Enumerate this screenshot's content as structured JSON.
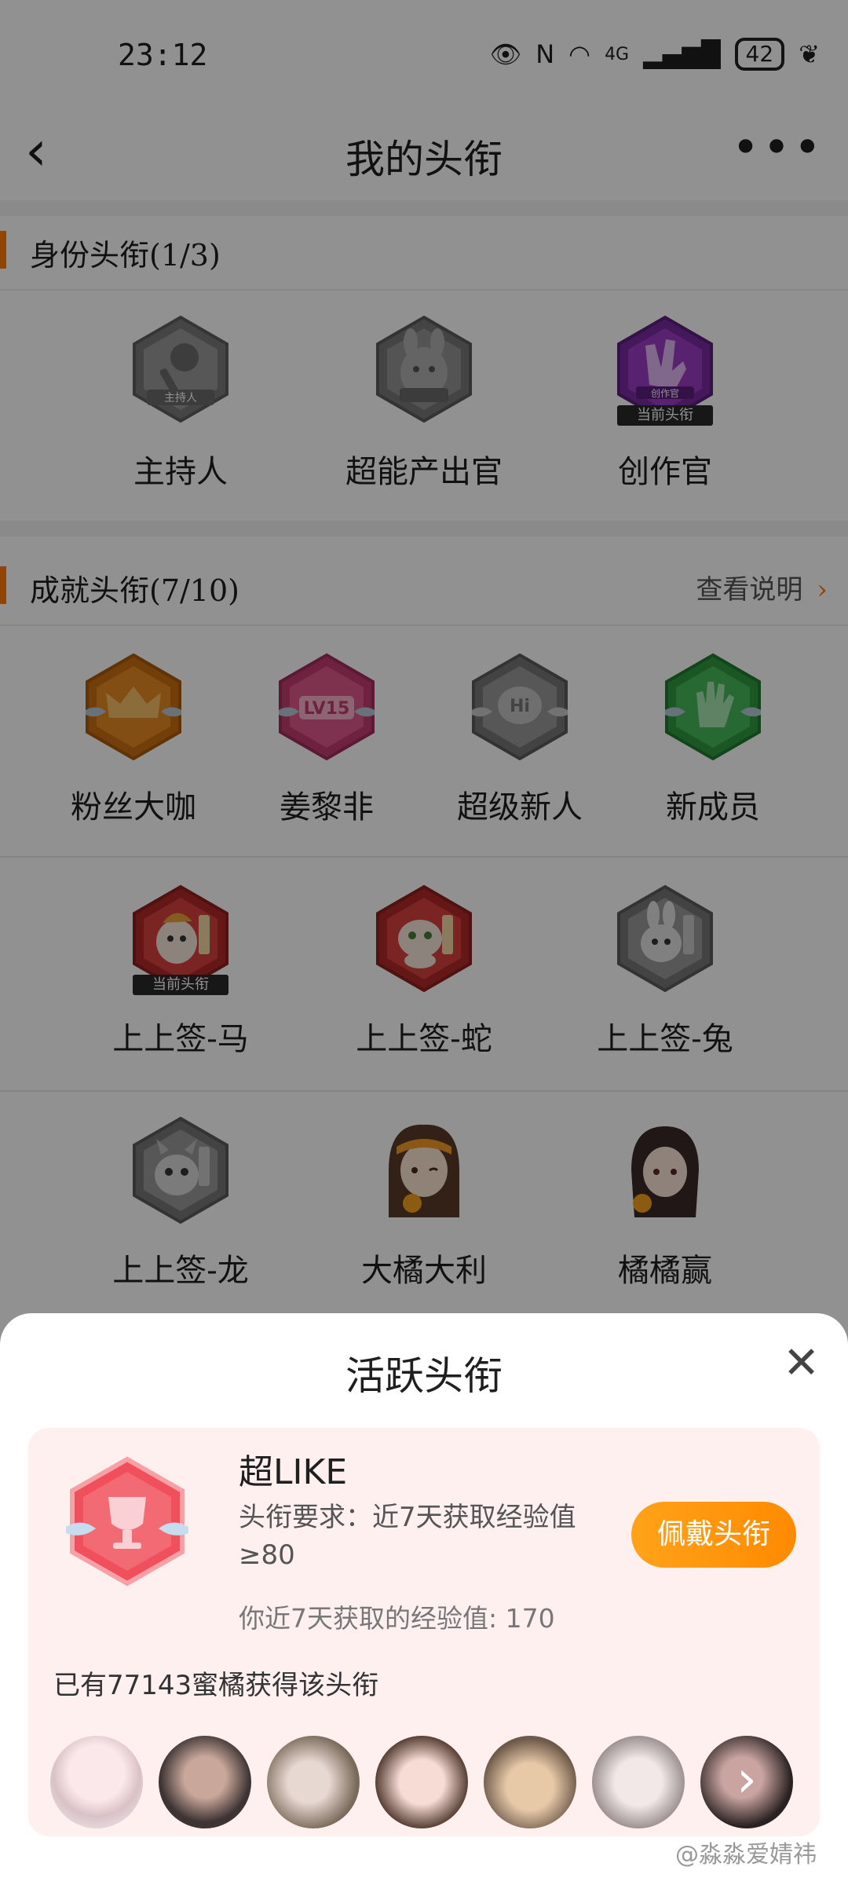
{
  "status_bar": {
    "time": "23:12",
    "network": "4G",
    "battery": "42"
  },
  "nav": {
    "title": "我的头衔"
  },
  "identity": {
    "title": "身份头衔(1/3)",
    "badges": [
      {
        "label": "主持人",
        "plate": "主持人"
      },
      {
        "label": "超能产出官"
      },
      {
        "label": "创作官",
        "plate": "创作官",
        "tag": "当前头衔"
      }
    ]
  },
  "achievement": {
    "title": "成就头衔(7/10)",
    "link": "查看说明",
    "row1": [
      {
        "label": "粉丝大咖"
      },
      {
        "label": "姜黎非",
        "plate": "LV15"
      },
      {
        "label": "超级新人",
        "plate": "Hi"
      },
      {
        "label": "新成员"
      }
    ],
    "row2": [
      {
        "label": "上上签-马",
        "tag": "当前头衔"
      },
      {
        "label": "上上签-蛇"
      },
      {
        "label": "上上签-兔"
      }
    ],
    "row3": [
      {
        "label": "上上签-龙"
      },
      {
        "label": "大橘大利"
      },
      {
        "label": "橘橘赢"
      }
    ]
  },
  "sheet": {
    "title": "活跃头衔",
    "badge_name": "超LIKE",
    "requirement": "头衔要求：近7天获取经验值≥80",
    "exp": "你近7天获取的经验值: 170",
    "wear_button": "佩戴头衔",
    "owners": "已有77143蜜橘获得该头衔"
  },
  "watermark": "@淼淼爱婧祎",
  "colors": {
    "accent": "#ff7a00",
    "sheet_card": "#fff0f0"
  }
}
